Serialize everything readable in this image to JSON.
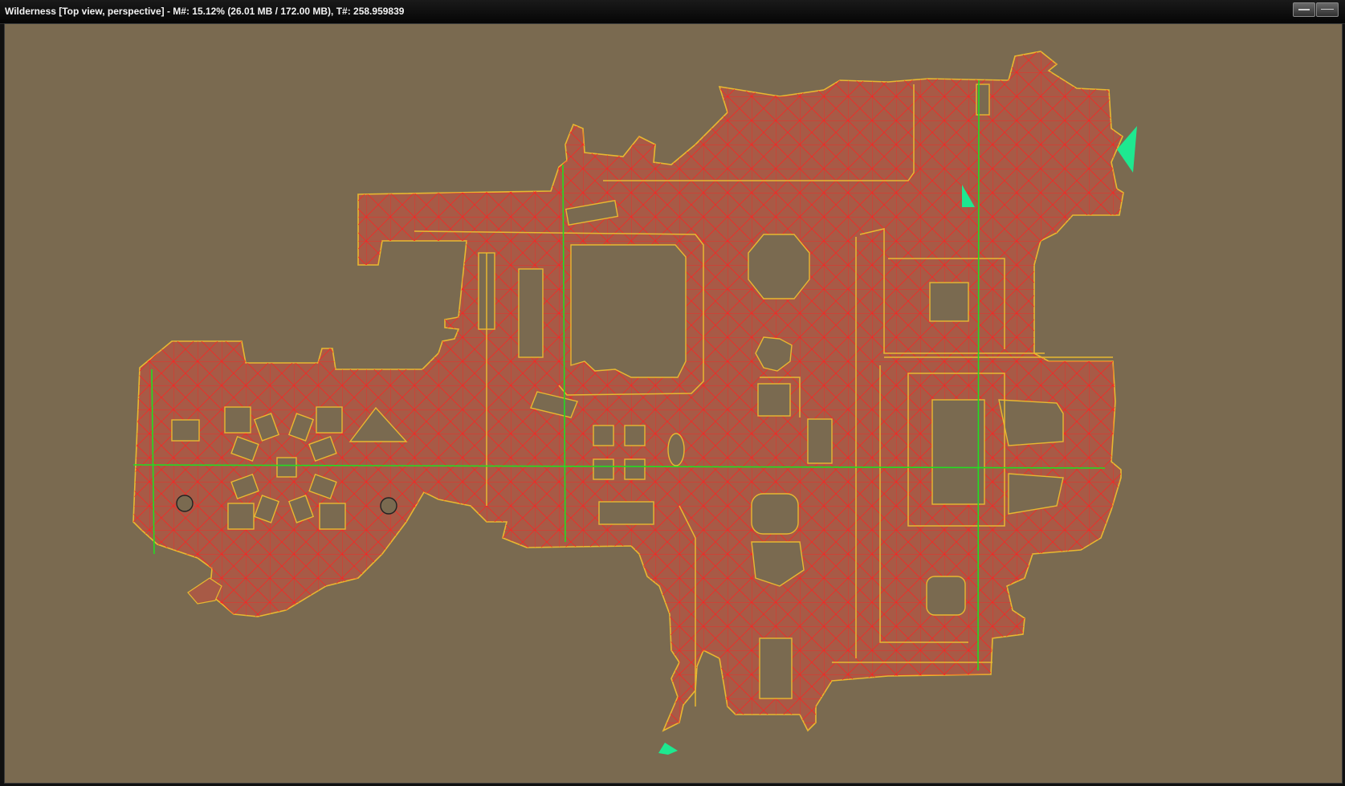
{
  "window": {
    "title": "Wilderness [Top view, perspective] - M#: 15.12% (26.01 MB / 172.00 MB), T#: 258.959839"
  },
  "colors": {
    "background": "#7a6a50",
    "navmesh_fill": "#a85a46",
    "navmesh_edges": "#ff1a1a",
    "boundary": "#e8b830",
    "axis_lines": "#22dd22",
    "markers": "#1ee890"
  },
  "icons": [
    "minimize-icon",
    "close-icon"
  ]
}
